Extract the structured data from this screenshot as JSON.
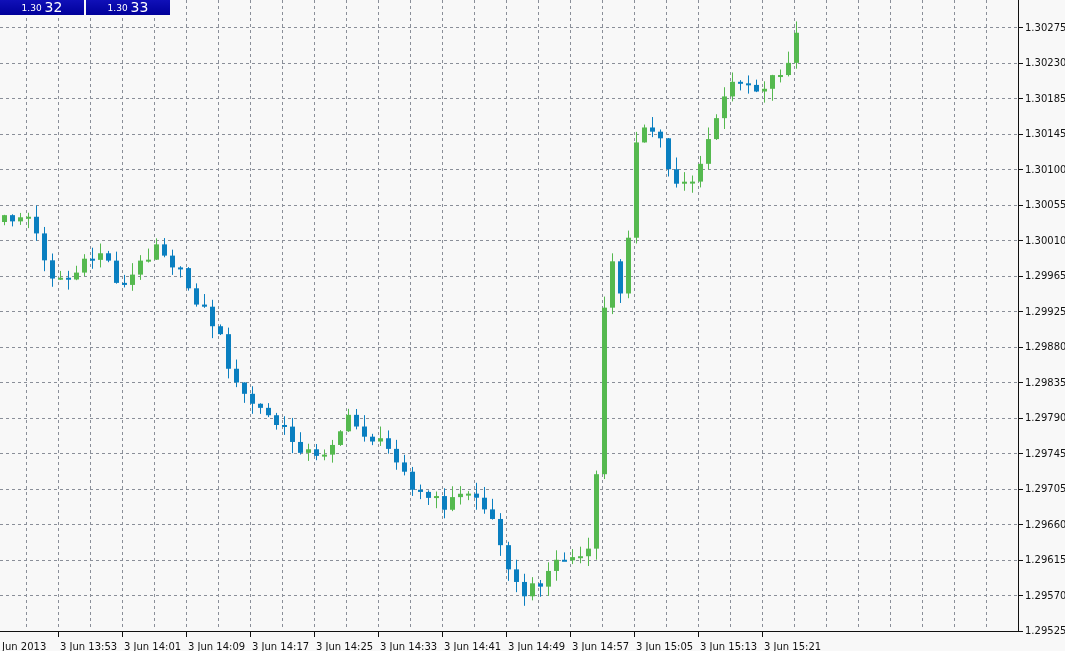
{
  "price_boxes": [
    {
      "prefix": "1.30",
      "digits": "32"
    },
    {
      "prefix": "1.30",
      "digits": "33"
    }
  ],
  "price_axis": {
    "labels": [
      "1.30275",
      "1.30230",
      "1.30185",
      "1.30145",
      "1.30100",
      "1.30055",
      "1.30010",
      "1.29965",
      "1.29925",
      "1.29880",
      "1.29835",
      "1.29790",
      "1.29745",
      "1.29705",
      "1.29660",
      "1.29615",
      "1.29570",
      "1.29525"
    ]
  },
  "time_axis": {
    "labels": [
      "Jun 2013",
      "3 Jun 13:53",
      "3 Jun 14:01",
      "3 Jun 14:09",
      "3 Jun 14:17",
      "3 Jun 14:25",
      "3 Jun 14:33",
      "3 Jun 14:41",
      "3 Jun 14:49",
      "3 Jun 14:57",
      "3 Jun 15:05",
      "3 Jun 15:13",
      "3 Jun 15:21"
    ]
  }
}
